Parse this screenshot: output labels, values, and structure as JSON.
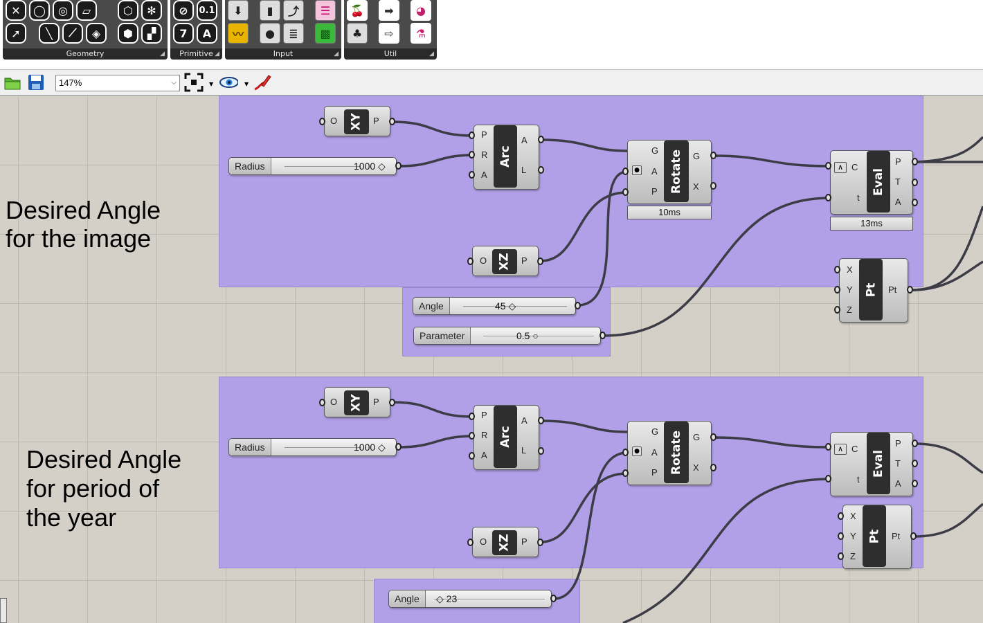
{
  "ribbon": {
    "panels": [
      {
        "label": "Geometry"
      },
      {
        "label": "Primitive"
      },
      {
        "label": "Input"
      },
      {
        "label": "Util"
      }
    ],
    "primitive_number_label": "0.1",
    "primitive_seven_label": "7",
    "primitive_text_label": "A"
  },
  "toolbar": {
    "zoom": "147%"
  },
  "canvas": {
    "group1": {
      "note": "Desired Angle\nfor the image",
      "plane_xy": {
        "in": "O",
        "core": "XY",
        "out": "P"
      },
      "radius": {
        "label": "Radius",
        "value": "1000 ◇"
      },
      "arc": {
        "in": [
          "P",
          "R",
          "A"
        ],
        "core": "Arc",
        "out": [
          "A",
          "L"
        ]
      },
      "rotate": {
        "in": [
          "G",
          "A",
          "P"
        ],
        "core": "Rotate",
        "out": [
          "G",
          "X"
        ],
        "timer": "10ms"
      },
      "eval": {
        "in": [
          "C",
          "t"
        ],
        "core": "Eval",
        "out": [
          "P",
          "T",
          "A"
        ],
        "timer": "13ms"
      },
      "plane_xz": {
        "in": "O",
        "core": "XZ",
        "out": "P"
      },
      "pt": {
        "in": [
          "X",
          "Y",
          "Z"
        ],
        "core": "Pt",
        "out": "Pt"
      },
      "angle": {
        "label": "Angle",
        "value": "45 ◇"
      },
      "parameter": {
        "label": "Parameter",
        "value": "0.5 ○"
      }
    },
    "group2": {
      "note": "Desired Angle\nfor period of\nthe year",
      "plane_xy": {
        "in": "O",
        "core": "XY",
        "out": "P"
      },
      "radius": {
        "label": "Radius",
        "value": "1000 ◇"
      },
      "arc": {
        "in": [
          "P",
          "R",
          "A"
        ],
        "core": "Arc",
        "out": [
          "A",
          "L"
        ]
      },
      "rotate": {
        "in": [
          "G",
          "A",
          "P"
        ],
        "core": "Rotate",
        "out": [
          "G",
          "X"
        ]
      },
      "eval": {
        "in": [
          "C",
          "t"
        ],
        "core": "Eval",
        "out": [
          "P",
          "T",
          "A"
        ]
      },
      "plane_xz": {
        "in": "O",
        "core": "XZ",
        "out": "P"
      },
      "pt": {
        "in": [
          "X",
          "Y",
          "Z"
        ],
        "core": "Pt",
        "out": "Pt"
      },
      "angle": {
        "label": "Angle",
        "value": "◇ 23"
      }
    }
  },
  "colors": {
    "group_fill": "#b19fe7",
    "canvas_bg": "#d4d0c8",
    "wire": "#3c3c46"
  }
}
